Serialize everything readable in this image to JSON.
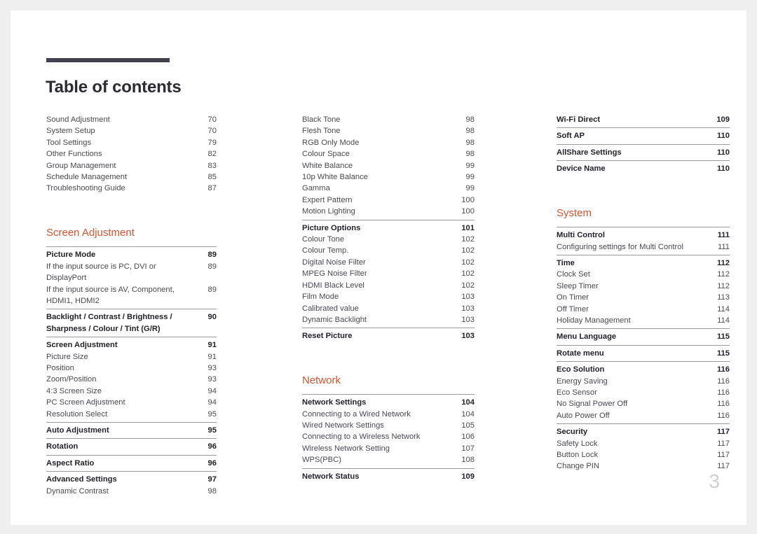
{
  "page": {
    "title": "Table of contents",
    "folio": "3",
    "accent_color": "#d1552f",
    "rule_color": "#43414f",
    "background": "#efefef",
    "paper": "#ffffff"
  },
  "columns": [
    {
      "id": "column-left",
      "blocks": [
        {
          "type": "list",
          "rule": false,
          "entries": [
            {
              "label": "Sound Adjustment",
              "page": "70",
              "bold": false
            },
            {
              "label": "System Setup",
              "page": "70",
              "bold": false
            },
            {
              "label": "Tool Settings",
              "page": "79",
              "bold": false
            },
            {
              "label": "Other Functions",
              "page": "82",
              "bold": false
            },
            {
              "label": "Group Management",
              "page": "83",
              "bold": false
            },
            {
              "label": "Schedule Management",
              "page": "85",
              "bold": false
            },
            {
              "label": "Troubleshooting Guide",
              "page": "87",
              "bold": false
            }
          ]
        },
        {
          "type": "section",
          "heading": "Screen Adjustment"
        },
        {
          "type": "list",
          "rule": true,
          "entries": [
            {
              "label": "Picture Mode",
              "page": "89",
              "bold": true
            },
            {
              "label": "If the input source is PC, DVI or DisplayPort",
              "page": "89",
              "bold": false
            },
            {
              "label": "If the input source is AV, Component, HDMI1, HDMI2",
              "page": "89",
              "bold": false,
              "wrap": true
            }
          ]
        },
        {
          "type": "list",
          "rule": true,
          "entries": [
            {
              "label": "Backlight / Contrast / Brightness / Sharpness / Colour / Tint (G/R)",
              "page": "90",
              "bold": true,
              "wrap": true
            }
          ]
        },
        {
          "type": "list",
          "rule": true,
          "entries": [
            {
              "label": "Screen Adjustment",
              "page": "91",
              "bold": true
            },
            {
              "label": "Picture Size",
              "page": "91",
              "bold": false
            },
            {
              "label": "Position",
              "page": "93",
              "bold": false
            },
            {
              "label": "Zoom/Position",
              "page": "93",
              "bold": false
            },
            {
              "label": "4:3 Screen Size",
              "page": "94",
              "bold": false
            },
            {
              "label": "PC Screen Adjustment",
              "page": "94",
              "bold": false
            },
            {
              "label": "Resolution Select",
              "page": "95",
              "bold": false
            }
          ]
        },
        {
          "type": "list",
          "rule": true,
          "entries": [
            {
              "label": "Auto Adjustment",
              "page": "95",
              "bold": true
            }
          ]
        },
        {
          "type": "list",
          "rule": true,
          "entries": [
            {
              "label": "Rotation",
              "page": "96",
              "bold": true
            }
          ]
        },
        {
          "type": "list",
          "rule": true,
          "entries": [
            {
              "label": "Aspect Ratio",
              "page": "96",
              "bold": true
            }
          ]
        },
        {
          "type": "list",
          "rule": true,
          "entries": [
            {
              "label": "Advanced Settings",
              "page": "97",
              "bold": true
            },
            {
              "label": "Dynamic Contrast",
              "page": "98",
              "bold": false
            }
          ]
        }
      ]
    },
    {
      "id": "column-middle",
      "blocks": [
        {
          "type": "list",
          "rule": false,
          "entries": [
            {
              "label": "Black Tone",
              "page": "98",
              "bold": false
            },
            {
              "label": "Flesh Tone",
              "page": "98",
              "bold": false
            },
            {
              "label": "RGB Only Mode",
              "page": "98",
              "bold": false
            },
            {
              "label": "Colour Space",
              "page": "98",
              "bold": false
            },
            {
              "label": "White Balance",
              "page": "99",
              "bold": false
            },
            {
              "label": "10p White Balance",
              "page": "99",
              "bold": false
            },
            {
              "label": "Gamma",
              "page": "99",
              "bold": false
            },
            {
              "label": "Expert Pattern",
              "page": "100",
              "bold": false
            },
            {
              "label": "Motion Lighting",
              "page": "100",
              "bold": false
            }
          ]
        },
        {
          "type": "list",
          "rule": true,
          "entries": [
            {
              "label": "Picture Options",
              "page": "101",
              "bold": true
            },
            {
              "label": "Colour Tone",
              "page": "102",
              "bold": false
            },
            {
              "label": "Colour Temp.",
              "page": "102",
              "bold": false
            },
            {
              "label": "Digital Noise Filter",
              "page": "102",
              "bold": false
            },
            {
              "label": "MPEG Noise Filter",
              "page": "102",
              "bold": false
            },
            {
              "label": "HDMI Black Level",
              "page": "102",
              "bold": false
            },
            {
              "label": "Film Mode",
              "page": "103",
              "bold": false
            },
            {
              "label": "Calibrated value",
              "page": "103",
              "bold": false
            },
            {
              "label": "Dynamic Backlight",
              "page": "103",
              "bold": false
            }
          ]
        },
        {
          "type": "list",
          "rule": true,
          "entries": [
            {
              "label": "Reset Picture",
              "page": "103",
              "bold": true
            }
          ]
        },
        {
          "type": "section",
          "heading": "Network"
        },
        {
          "type": "list",
          "rule": true,
          "entries": [
            {
              "label": "Network Settings",
              "page": "104",
              "bold": true
            },
            {
              "label": "Connecting to a Wired Network",
              "page": "104",
              "bold": false
            },
            {
              "label": "Wired Network Settings",
              "page": "105",
              "bold": false
            },
            {
              "label": "Connecting to a Wireless Network",
              "page": "106",
              "bold": false
            },
            {
              "label": "Wireless Network Setting",
              "page": "107",
              "bold": false
            },
            {
              "label": "WPS(PBC)",
              "page": "108",
              "bold": false
            }
          ]
        },
        {
          "type": "list",
          "rule": true,
          "entries": [
            {
              "label": "Network Status",
              "page": "109",
              "bold": true
            }
          ]
        }
      ]
    },
    {
      "id": "column-right",
      "blocks": [
        {
          "type": "list",
          "rule": false,
          "entries": [
            {
              "label": "Wi-Fi Direct",
              "page": "109",
              "bold": true
            }
          ]
        },
        {
          "type": "list",
          "rule": true,
          "entries": [
            {
              "label": "Soft AP",
              "page": "110",
              "bold": true
            }
          ]
        },
        {
          "type": "list",
          "rule": true,
          "entries": [
            {
              "label": "AllShare Settings",
              "page": "110",
              "bold": true
            }
          ]
        },
        {
          "type": "list",
          "rule": true,
          "entries": [
            {
              "label": "Device Name",
              "page": "110",
              "bold": true
            }
          ]
        },
        {
          "type": "section",
          "heading": "System"
        },
        {
          "type": "list",
          "rule": true,
          "entries": [
            {
              "label": "Multi Control",
              "page": "111",
              "bold": true
            },
            {
              "label": "Configuring settings for Multi Control",
              "page": "111",
              "bold": false
            }
          ]
        },
        {
          "type": "list",
          "rule": true,
          "entries": [
            {
              "label": "Time",
              "page": "112",
              "bold": true
            },
            {
              "label": "Clock Set",
              "page": "112",
              "bold": false
            },
            {
              "label": "Sleep Timer",
              "page": "112",
              "bold": false
            },
            {
              "label": "On Timer",
              "page": "113",
              "bold": false
            },
            {
              "label": "Off Timer",
              "page": "114",
              "bold": false
            },
            {
              "label": "Holiday Management",
              "page": "114",
              "bold": false
            }
          ]
        },
        {
          "type": "list",
          "rule": true,
          "entries": [
            {
              "label": "Menu Language",
              "page": "115",
              "bold": true
            }
          ]
        },
        {
          "type": "list",
          "rule": true,
          "entries": [
            {
              "label": "Rotate menu",
              "page": "115",
              "bold": true
            }
          ]
        },
        {
          "type": "list",
          "rule": true,
          "entries": [
            {
              "label": "Eco Solution",
              "page": "116",
              "bold": true
            },
            {
              "label": "Energy Saving",
              "page": "116",
              "bold": false
            },
            {
              "label": "Eco Sensor",
              "page": "116",
              "bold": false
            },
            {
              "label": "No Signal Power Off",
              "page": "116",
              "bold": false
            },
            {
              "label": "Auto Power Off",
              "page": "116",
              "bold": false
            }
          ]
        },
        {
          "type": "list",
          "rule": true,
          "entries": [
            {
              "label": "Security",
              "page": "117",
              "bold": true
            },
            {
              "label": "Safety Lock",
              "page": "117",
              "bold": false
            },
            {
              "label": "Button Lock",
              "page": "117",
              "bold": false
            },
            {
              "label": "Change PIN",
              "page": "117",
              "bold": false
            }
          ]
        }
      ]
    }
  ]
}
